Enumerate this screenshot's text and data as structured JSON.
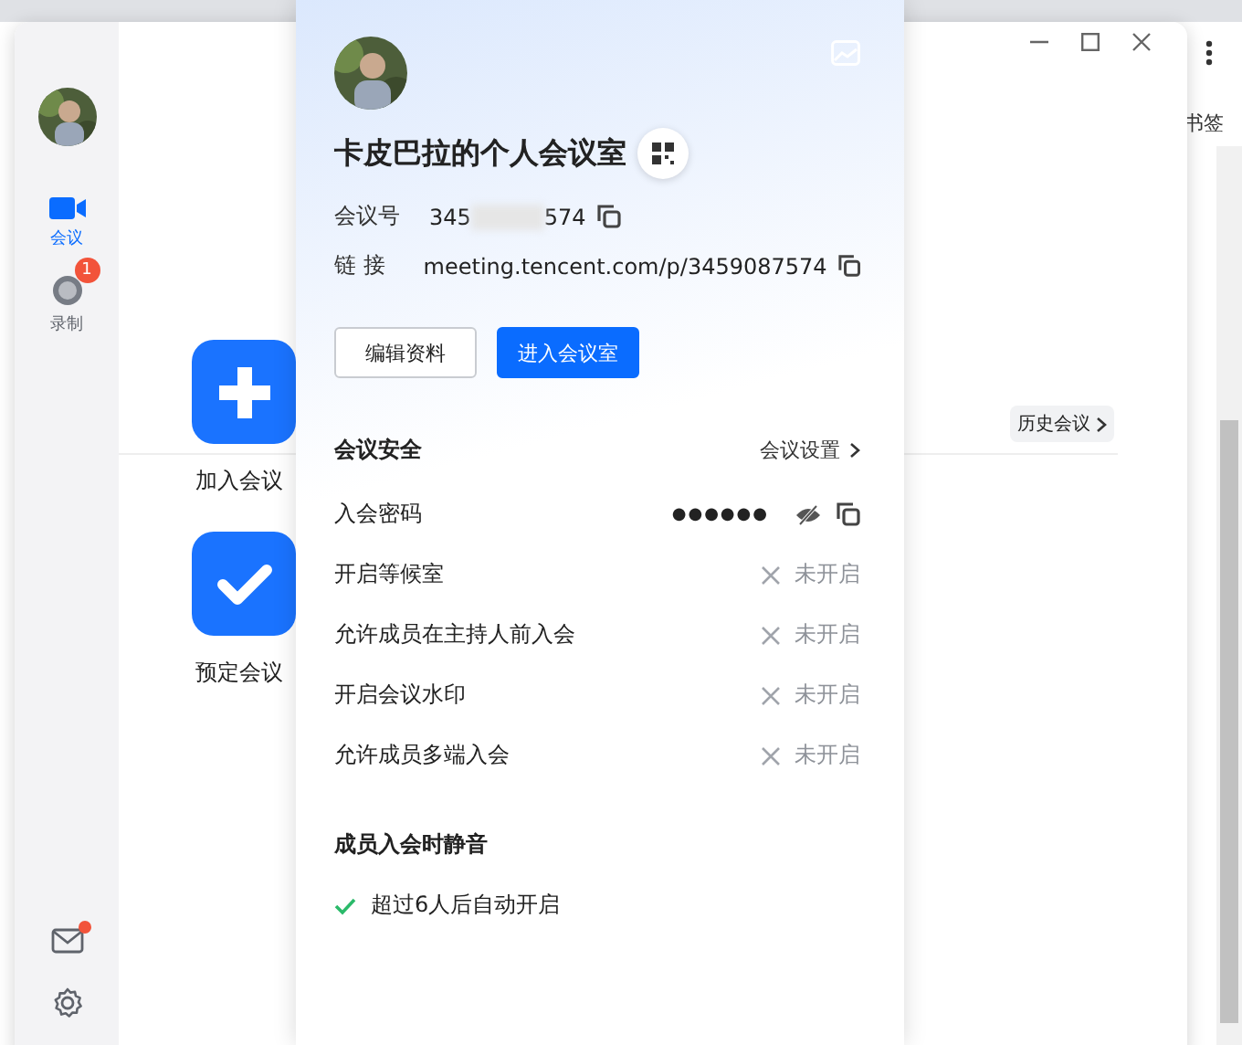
{
  "browser": {
    "bookmark_label": "书签"
  },
  "sidebar": {
    "items": [
      {
        "label": "会议",
        "kind": "video",
        "selected": true
      },
      {
        "label": "录制",
        "kind": "record",
        "selected": false,
        "badge": "1"
      }
    ],
    "mail_unread": true
  },
  "main": {
    "actions": [
      {
        "label": "加入会议",
        "kind": "join"
      },
      {
        "label": "预定会议",
        "kind": "schedule"
      }
    ],
    "history_button": "历史会议"
  },
  "room_card": {
    "title": "卡皮巴拉的个人会议室",
    "meeting_id": {
      "label": "会议号",
      "start": "345",
      "end": "574"
    },
    "link": {
      "label": "链 接",
      "value": "meeting.tencent.com/p/3459087574"
    },
    "buttons": [
      {
        "label": "编辑资料",
        "primary": false
      },
      {
        "label": "进入会议室",
        "primary": true
      }
    ],
    "security": {
      "title": "会议安全",
      "settings_link": "会议设置",
      "password": {
        "label": "入会密码",
        "value": "●●●●●●"
      },
      "options": [
        {
          "label": "开启等候室",
          "on": false,
          "status": "未开启"
        },
        {
          "label": "允许成员在主持人前入会",
          "on": false,
          "status": "未开启"
        },
        {
          "label": "开启会议水印",
          "on": false,
          "status": "未开启"
        },
        {
          "label": "允许成员多端入会",
          "on": false,
          "status": "未开启"
        }
      ]
    },
    "mute": {
      "title": "成员入会时静音",
      "options": [
        {
          "label": "超过6人后自动开启",
          "on": true
        }
      ]
    }
  }
}
